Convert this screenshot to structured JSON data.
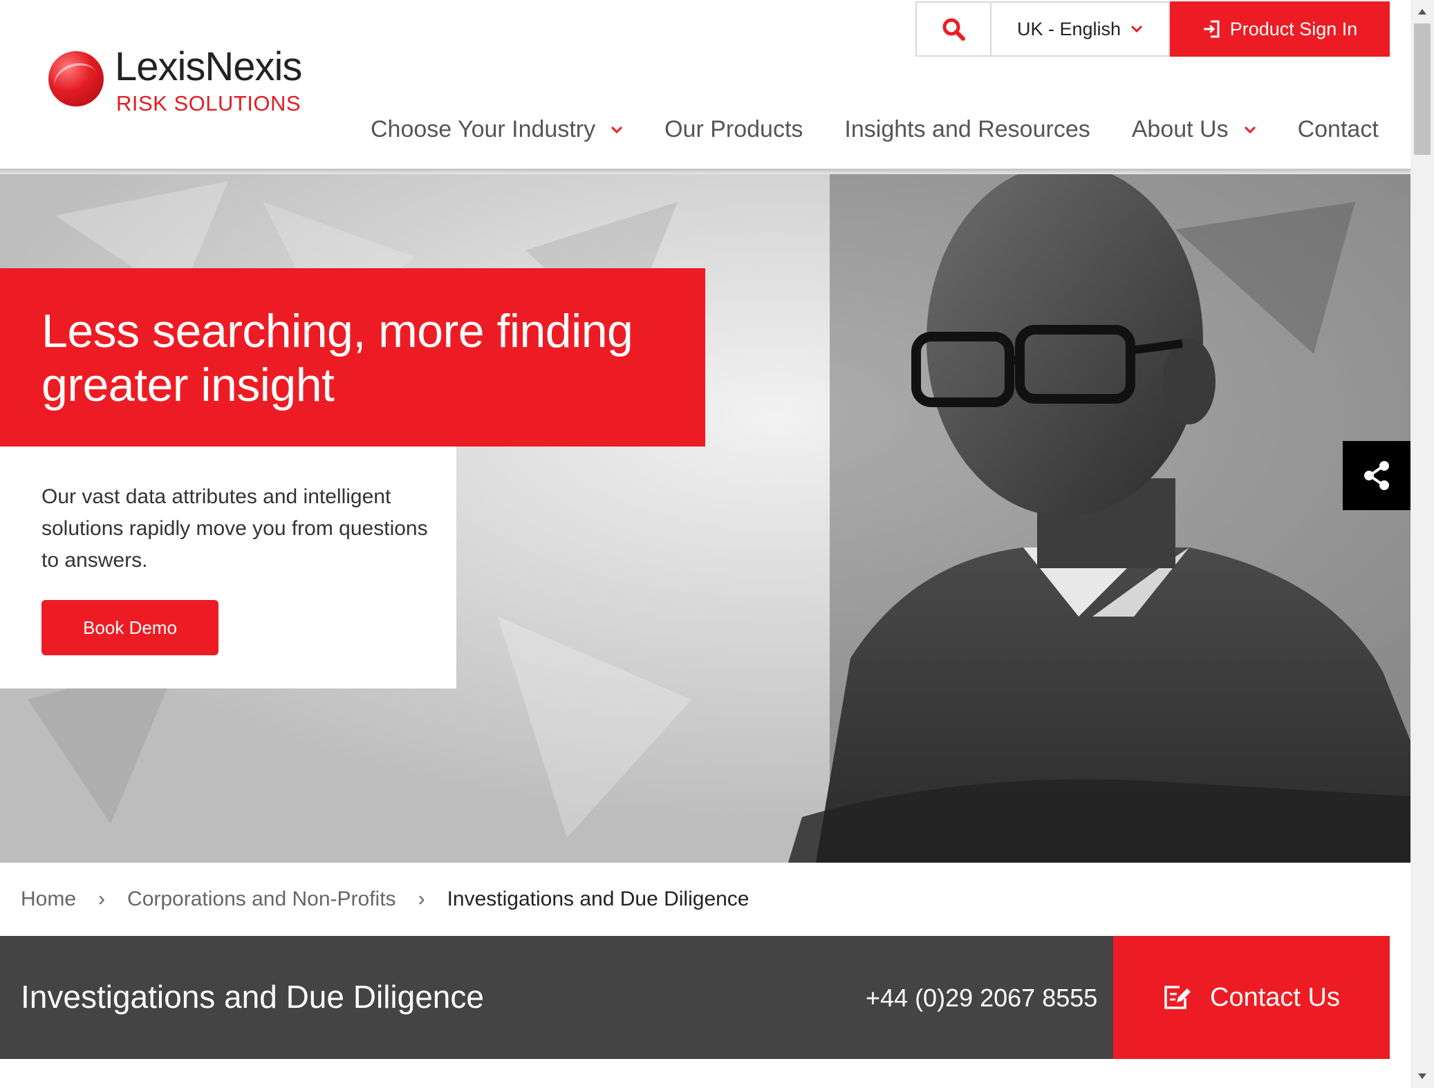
{
  "brand": {
    "name": "LexisNexis",
    "tagline": "RISK SOLUTIONS",
    "accent_color": "#ed1c24"
  },
  "utility": {
    "search_icon": "search-icon",
    "language": "UK - English",
    "sign_in": "Product Sign In"
  },
  "nav": {
    "items": [
      {
        "label": "Choose Your Industry",
        "has_dropdown": true
      },
      {
        "label": "Our Products",
        "has_dropdown": false
      },
      {
        "label": "Insights and Resources",
        "has_dropdown": false
      },
      {
        "label": "About Us",
        "has_dropdown": true
      },
      {
        "label": "Contact",
        "has_dropdown": false
      }
    ]
  },
  "hero": {
    "title_line1": "Less searching, more finding",
    "title_line2": "greater insight",
    "body": "Our vast data attributes and intelligent solutions rapidly move you from questions to answers.",
    "cta": "Book Demo"
  },
  "breadcrumb": {
    "items": [
      "Home",
      "Corporations and Non-Profits",
      "Investigations and Due Diligence"
    ]
  },
  "band": {
    "title": "Investigations and Due Diligence",
    "phone": "+44 (0)29 2067 8555",
    "contact_label": "Contact Us"
  }
}
